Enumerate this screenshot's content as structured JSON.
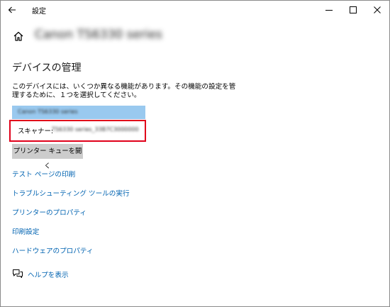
{
  "titlebar": {
    "back_icon": "back-arrow-icon",
    "title": "設定",
    "minimize_icon": "minimize-icon",
    "maximize_icon": "maximize-icon",
    "close_icon": "close-icon"
  },
  "header": {
    "home_icon": "home-icon",
    "device_name": "Canon TS6330 series"
  },
  "main": {
    "section_title": "デバイスの管理",
    "description": "このデバイスには、いくつか異なる機能があります。その機能の設定を管理するために、１つを選択してください。",
    "devices": [
      {
        "label": "Canon TS6330 series"
      },
      {
        "prefix": "スキャナー:",
        "label": "TS6330 series_33B7C3000000"
      }
    ],
    "highlight_color": "#e0001a",
    "open_queue_label": "プリンター キューを開く",
    "links": [
      "テスト ページの印刷",
      "トラブルシューティング ツールの実行",
      "プリンターのプロパティ",
      "印刷設定",
      "ハードウェアのプロパティ"
    ],
    "help_icon": "chat-help-icon",
    "help_label": "ヘルプを表示"
  },
  "colors": {
    "link": "#0063b1",
    "selected_item": "#99c9ef",
    "button": "#cccccc"
  }
}
